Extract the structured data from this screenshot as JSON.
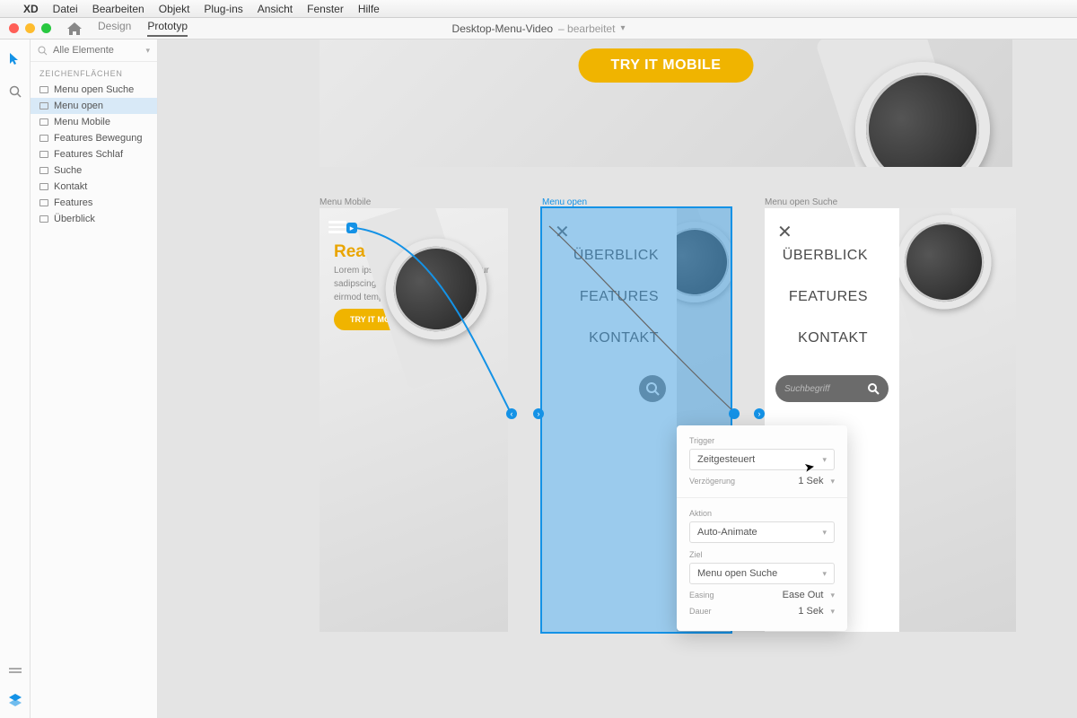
{
  "menubar": {
    "app": "XD",
    "items": [
      "Datei",
      "Bearbeiten",
      "Objekt",
      "Plug-ins",
      "Ansicht",
      "Fenster",
      "Hilfe"
    ]
  },
  "titlebar": {
    "tab_design": "Design",
    "tab_prototype": "Prototyp",
    "doc": "Desktop-Menu-Video",
    "modified": "– bearbeitet"
  },
  "layers": {
    "search_placeholder": "Alle Elemente",
    "section": "ZEICHENFLÄCHEN",
    "items": [
      "Menu open Suche",
      "Menu open",
      "Menu Mobile",
      "Features Bewegung",
      "Features Schlaf",
      "Suche",
      "Kontakt",
      "Features",
      "Überblick"
    ],
    "selected_index": 1
  },
  "hero": {
    "cta": "TRY IT MOBILE"
  },
  "artboards": {
    "a": {
      "label": "Menu Mobile",
      "heading": "Ready to start",
      "body": "Lorem ipsum dolor sit amet, consetetur sadipscing elitr, sed diam nonumy eirmod tempor",
      "cta": "TRY IT MOBILE"
    },
    "b": {
      "label": "Menu open",
      "link1": "ÜBERBLICK",
      "link2": "FEATURES",
      "link3": "KONTAKT"
    },
    "c": {
      "label": "Menu open Suche",
      "link1": "ÜBERBLICK",
      "link2": "FEATURES",
      "link3": "KONTAKT",
      "search_placeholder": "Suchbegriff"
    }
  },
  "popover": {
    "trigger_label": "Trigger",
    "trigger_value": "Zeitgesteuert",
    "delay_label": "Verzögerung",
    "delay_value": "1 Sek",
    "action_label": "Aktion",
    "action_value": "Auto-Animate",
    "target_label": "Ziel",
    "target_value": "Menu open Suche",
    "easing_label": "Easing",
    "easing_value": "Ease Out",
    "duration_label": "Dauer",
    "duration_value": "1 Sek"
  }
}
